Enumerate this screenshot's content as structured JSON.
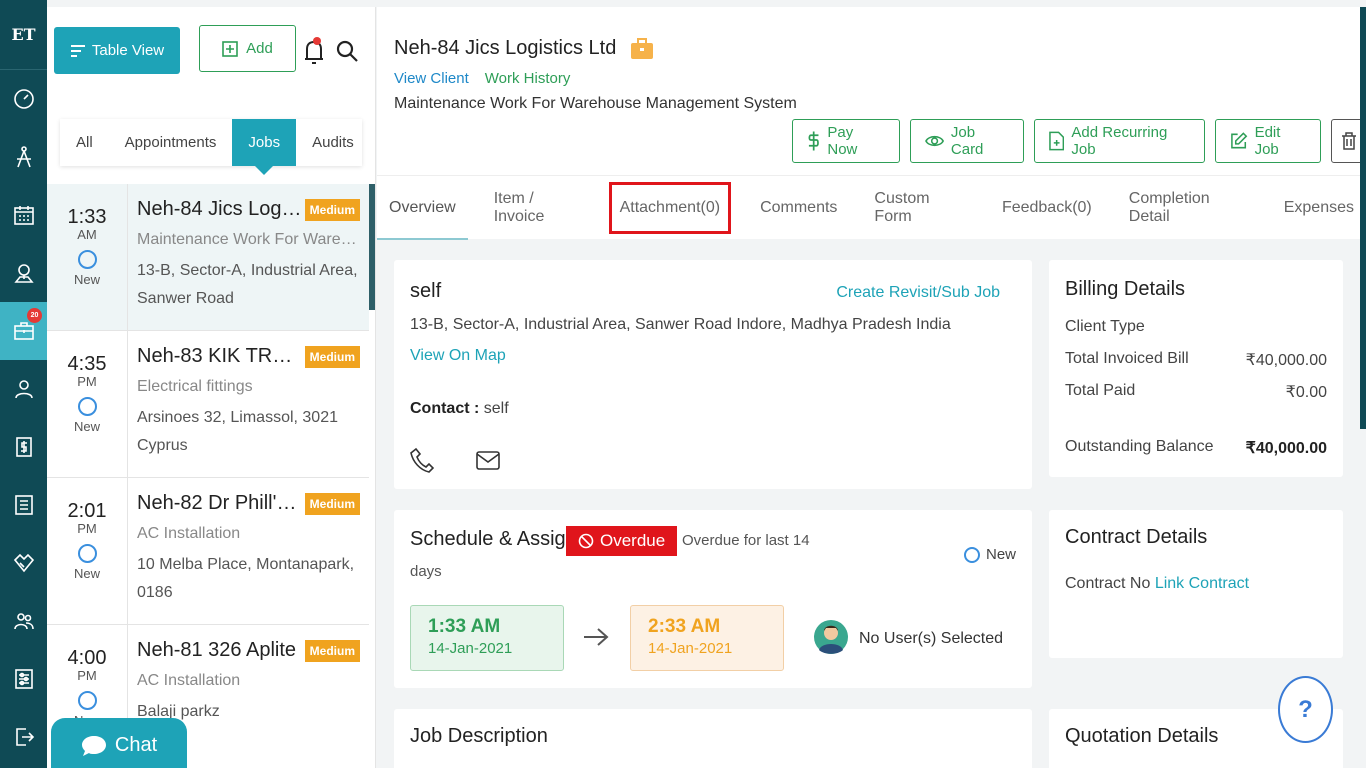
{
  "rail": {
    "logo": "ET",
    "badge": "20"
  },
  "toolbar": {
    "table_view_label": "Table View",
    "add_label": "Add"
  },
  "filters": [
    "All",
    "Appointments",
    "Jobs",
    "Audits"
  ],
  "jobs": [
    {
      "time": "1:33",
      "ampm": "AM",
      "status": "New",
      "title": "Neh-84 Jics Logist...",
      "priority": "Medium",
      "desc": "Maintenance Work For Wareh...",
      "addr": "13-B, Sector-A, Industrial Area, Sanwer Road"
    },
    {
      "time": "4:35",
      "ampm": "PM",
      "status": "New",
      "title": "Neh-83 KIK TRAD...",
      "priority": "Medium",
      "desc": "Electrical fittings",
      "addr": "Arsinoes 32, Limassol, 3021 Cyprus"
    },
    {
      "time": "2:01",
      "ampm": "PM",
      "status": "New",
      "title": "Neh-82 Dr Phill's ...",
      "priority": "Medium",
      "desc": "AC Installation",
      "addr": "10 Melba Place, Montanapark, 0186"
    },
    {
      "time": "4:00",
      "ampm": "PM",
      "status": "New",
      "title": "Neh-81 326 Aplite",
      "priority": "Medium",
      "desc": "AC Installation",
      "addr": "Balaji parkz"
    }
  ],
  "chat_label": "Chat",
  "header": {
    "title": "Neh-84 Jics Logistics Ltd",
    "view_client": "View Client",
    "work_history": "Work History",
    "description": "Maintenance Work For Warehouse Management System",
    "actions": {
      "pay_now": "Pay Now",
      "job_card": "Job Card",
      "add_recurring": "Add Recurring Job",
      "edit_job": "Edit Job"
    }
  },
  "tabs": [
    "Overview",
    "Item / Invoice",
    "Attachment(0)",
    "Comments",
    "Custom Form",
    "Feedback(0)",
    "Completion Detail",
    "Expenses"
  ],
  "location": {
    "name": "self",
    "revisit": "Create Revisit/Sub Job",
    "address": "13-B, Sector-A, Industrial Area, Sanwer Road Indore, Madhya Pradesh India",
    "map_link": "View On Map",
    "contact_label": "Contact :",
    "contact_value": "self"
  },
  "schedule": {
    "title": "Schedule & Assign",
    "overdue": "Overdue",
    "overdue_text": "Overdue for last 14",
    "overdue_days": "days",
    "status": "New",
    "start_time": "1:33 AM",
    "start_date": "14-Jan-2021",
    "end_time": "2:33 AM",
    "end_date": "14-Jan-2021",
    "no_user": "No User(s) Selected"
  },
  "job_description_title": "Job Description",
  "billing": {
    "title": "Billing Details",
    "client_type_label": "Client Type",
    "invoiced_label": "Total Invoiced Bill",
    "invoiced_value": "₹40,000.00",
    "paid_label": "Total Paid",
    "paid_value": "₹0.00",
    "outstanding_label": "Outstanding Balance",
    "outstanding_value": "₹40,000.00"
  },
  "contract": {
    "title": "Contract Details",
    "no_label": "Contract No",
    "link": "Link Contract"
  },
  "quotation_title": "Quotation Details",
  "help_label": "?",
  "colors": {
    "rail": "#0f4a55",
    "accent": "#1ea3b7",
    "green": "#2e9e57",
    "orange": "#f0a31f",
    "red": "#e0151b"
  }
}
